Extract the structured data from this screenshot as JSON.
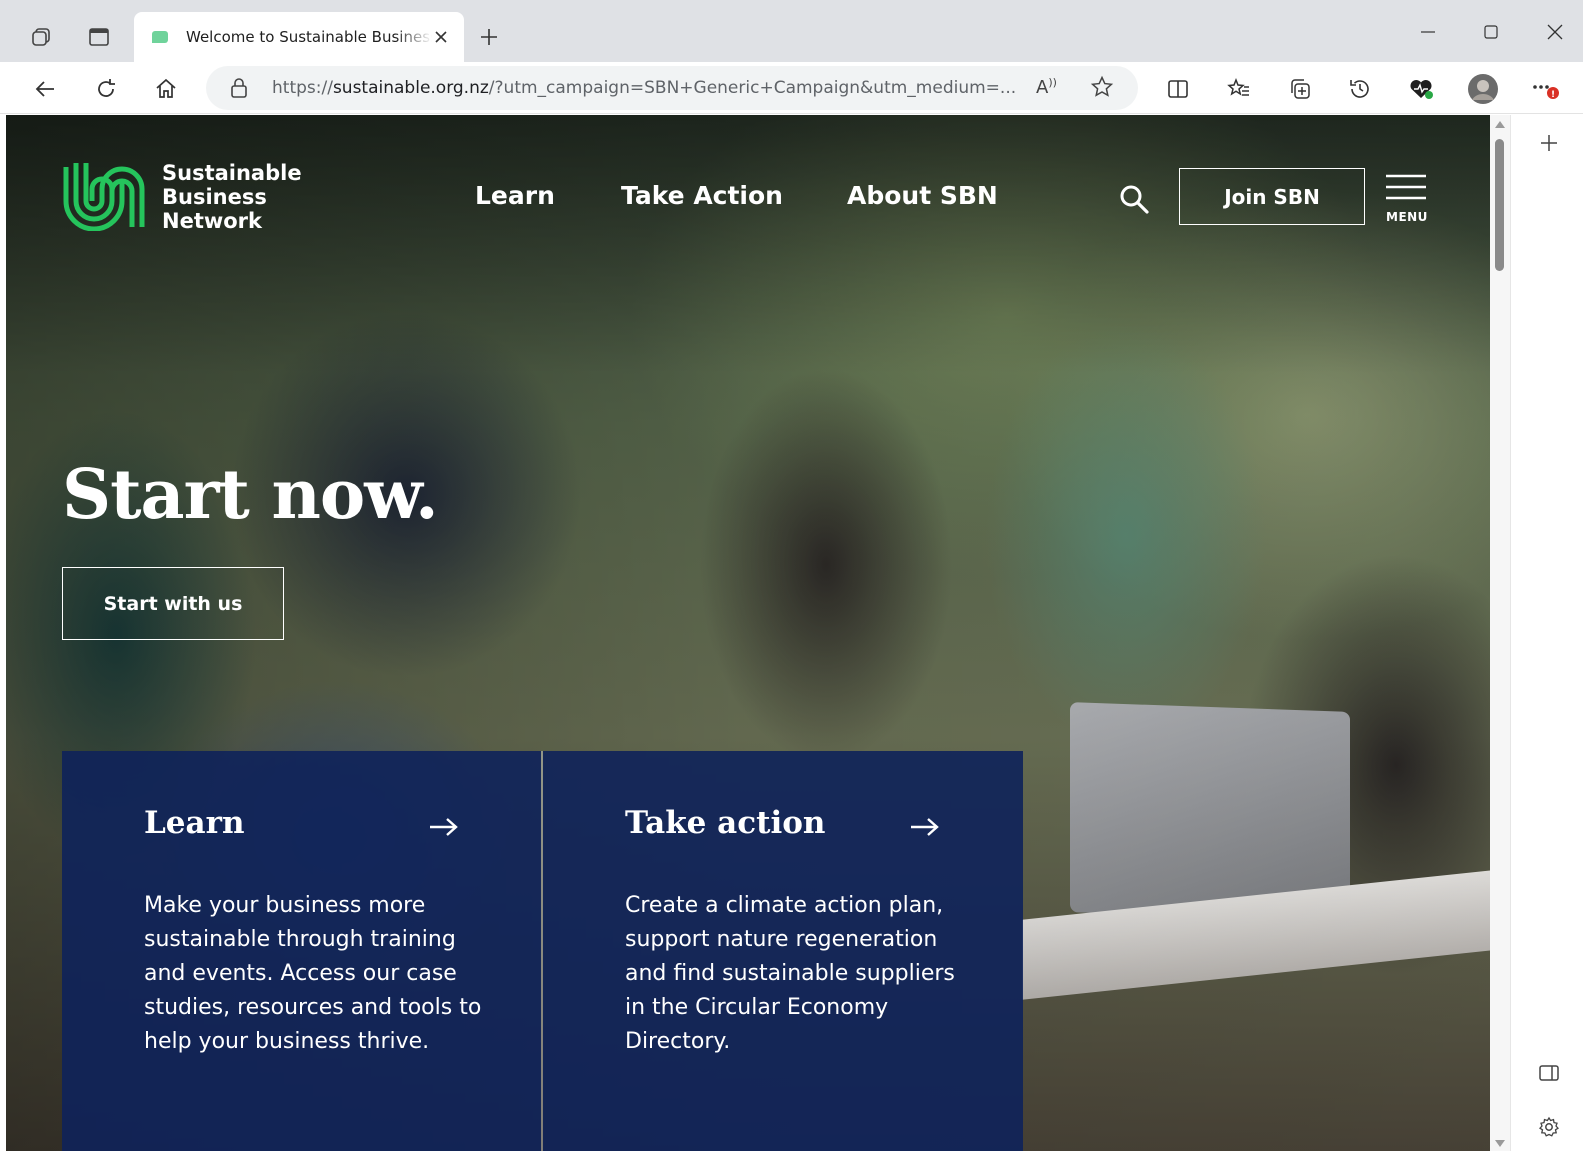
{
  "browser": {
    "tab": {
      "title": "Welcome to Sustainable Business Network"
    },
    "address_bar": {
      "url_prefix": "https://",
      "url_host": "sustainable.org.nz",
      "url_rest": "/?utm_campaign=SBN+Generic+Campaign&utm_medium=...",
      "read_aloud_label": "A⁾"
    },
    "icons": {
      "workspaces": "workspaces-icon",
      "vertical_tabs": "vertical-tabs-icon",
      "new_tab": "plus-icon",
      "back": "back-arrow-icon",
      "refresh": "refresh-icon",
      "home": "home-icon",
      "lock": "lock-icon",
      "favorite": "star-icon",
      "split_screen": "split-screen-icon",
      "favorites": "favorites-list-icon",
      "collections": "collections-icon",
      "history": "history-icon",
      "extension": "heart-extension-icon",
      "profile": "avatar",
      "more": "more-icon"
    }
  },
  "site": {
    "logo": {
      "line1": "Sustainable",
      "line2": "Business",
      "line3": "Network"
    },
    "nav": [
      {
        "label": "Learn"
      },
      {
        "label": "Take Action"
      },
      {
        "label": "About SBN"
      }
    ],
    "join_label": "Join SBN",
    "menu_label": "MENU",
    "hero": {
      "title": "Start now.",
      "cta_label": "Start with us"
    },
    "cards": [
      {
        "title": "Learn",
        "body": "Make your business more sustainable through training and events. Access our case studies, resources and tools to help your business thrive."
      },
      {
        "title": "Take action",
        "body": "Create a climate action plan, support nature regeneration and find sustainable suppliers in the Circular Economy Directory."
      }
    ],
    "colors": {
      "brand_green": "#25c45c",
      "card_navy": "#0e225a",
      "white": "#ffffff"
    }
  }
}
